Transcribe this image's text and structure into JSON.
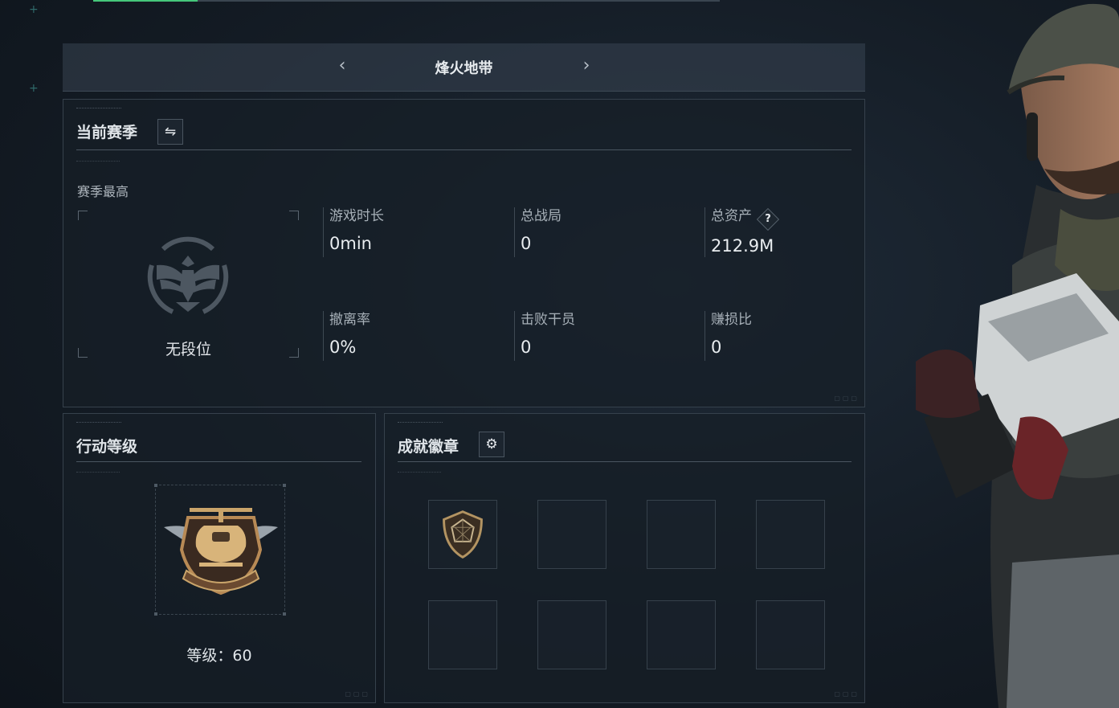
{
  "header": {
    "title": "烽火地带",
    "prev_icon": "chevron-left-icon",
    "next_icon": "chevron-right-icon"
  },
  "season": {
    "heading": "当前赛季",
    "switch_icon": "switch-arrows-icon",
    "best_label": "赛季最高",
    "rank_name": "无段位",
    "stats": [
      {
        "label": "游戏时长",
        "value": "0min"
      },
      {
        "label": "总战局",
        "value": "0"
      },
      {
        "label": "总资产",
        "value": "212.9M",
        "help": "?"
      },
      {
        "label": "撤离率",
        "value": "0%"
      },
      {
        "label": "击败干员",
        "value": "0"
      },
      {
        "label": "赚损比",
        "value": "0"
      }
    ]
  },
  "level": {
    "heading": "行动等级",
    "level_text": "等级：60"
  },
  "achievements": {
    "heading": "成就徽章",
    "settings_icon": "gear-icon",
    "slot_count": 8
  },
  "colors": {
    "accent_green": "#45c77a",
    "badge_gold": "#c9a46a"
  }
}
